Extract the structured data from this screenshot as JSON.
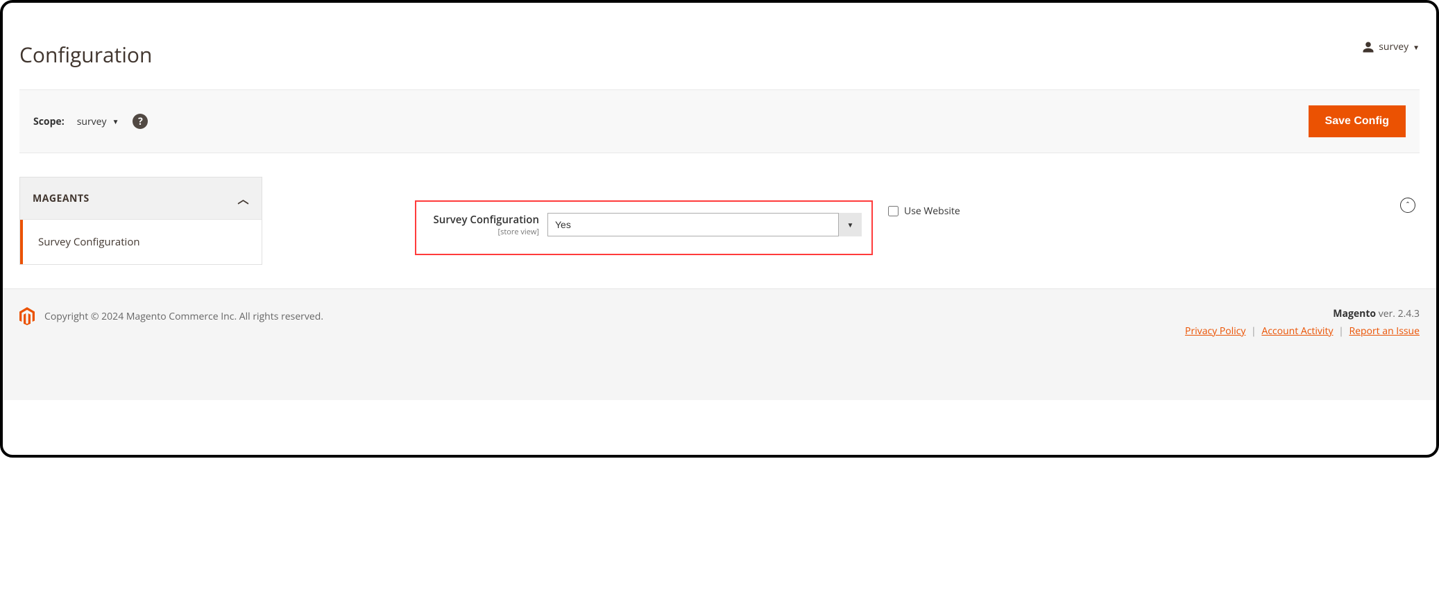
{
  "header": {
    "title": "Configuration",
    "user_label": "survey"
  },
  "scope_bar": {
    "label": "Scope:",
    "value": "survey",
    "save_label": "Save Config"
  },
  "sidebar": {
    "group_label": "MAGEANTS",
    "item_label": "Survey Configuration"
  },
  "config": {
    "field_label": "Survey Configuration",
    "scope_note": "[store view]",
    "value": "Yes",
    "use_website_label": "Use Website"
  },
  "footer": {
    "copyright": "Copyright © 2024 Magento Commerce Inc. All rights reserved.",
    "product": "Magento",
    "version": " ver. 2.4.3",
    "links": {
      "privacy": "Privacy Policy",
      "activity": " Account Activity",
      "report": "Report an Issue"
    }
  }
}
